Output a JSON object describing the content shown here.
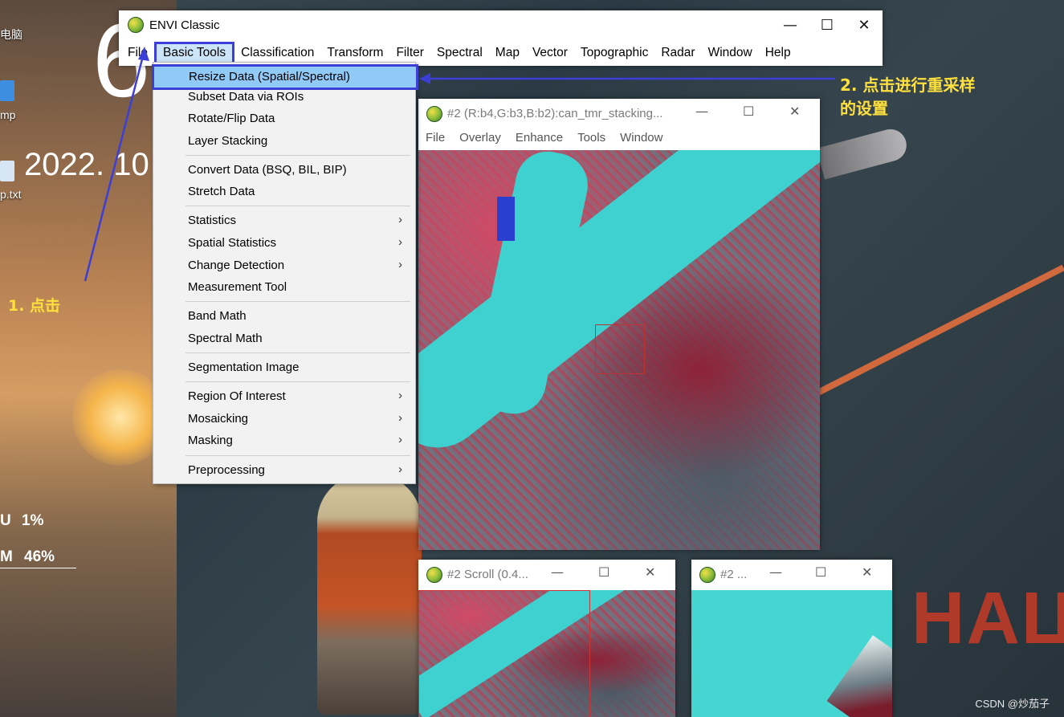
{
  "desktop": {
    "clock_digit": "6",
    "date": "2022. 10",
    "icons": [
      {
        "label": "电脑"
      },
      {
        "label": "mp"
      },
      {
        "label": "p.txt"
      }
    ],
    "stats": [
      {
        "label": "U",
        "value": "1%"
      },
      {
        "label": "M",
        "value": "46%"
      }
    ],
    "wall_text": "НАЦ",
    "watermark": "CSDN @炒茄子"
  },
  "annotations": {
    "step1": "1. 点击",
    "step2_line1": "2. 点击进行重采样",
    "step2_line2": "的设置",
    "accent_color": "#3b3fd6",
    "note_color": "#ffe03c"
  },
  "main_window": {
    "title": "ENVI Classic",
    "controls": {
      "minimize": "—",
      "maximize": "☐",
      "close": "✕"
    },
    "menus": [
      "File",
      "Basic Tools",
      "Classification",
      "Transform",
      "Filter",
      "Spectral",
      "Map",
      "Vector",
      "Topographic",
      "Radar",
      "Window",
      "Help"
    ],
    "active_menu": "Basic Tools"
  },
  "dropdown": {
    "items": [
      {
        "label": "Resize Data (Spatial/Spectral)",
        "submenu": false,
        "highlighted": true
      },
      {
        "label": "Subset Data via ROIs",
        "submenu": false
      },
      {
        "label": "Rotate/Flip Data",
        "submenu": false
      },
      {
        "label": "Layer Stacking",
        "submenu": false
      },
      {
        "label": "Convert Data (BSQ, BIL, BIP)",
        "submenu": false
      },
      {
        "label": "Stretch Data",
        "submenu": false
      },
      {
        "label": "Statistics",
        "submenu": true
      },
      {
        "label": "Spatial Statistics",
        "submenu": true
      },
      {
        "label": "Change Detection",
        "submenu": true
      },
      {
        "label": "Measurement Tool",
        "submenu": false
      },
      {
        "label": "Band Math",
        "submenu": false
      },
      {
        "label": "Spectral Math",
        "submenu": false
      },
      {
        "label": "Segmentation Image",
        "submenu": false
      },
      {
        "label": "Region Of Interest",
        "submenu": true
      },
      {
        "label": "Mosaicking",
        "submenu": true
      },
      {
        "label": "Masking",
        "submenu": true
      },
      {
        "label": "Preprocessing",
        "submenu": true
      }
    ],
    "submenu_arrow": "›"
  },
  "image_window": {
    "title": "#2 (R:b4,G:b3,B:b2):can_tmr_stacking...",
    "menus": [
      "File",
      "Overlay",
      "Enhance",
      "Tools",
      "Window"
    ]
  },
  "scroll_window": {
    "title": "#2 Scroll (0.4..."
  },
  "zoom_window": {
    "title": "#2 ..."
  }
}
